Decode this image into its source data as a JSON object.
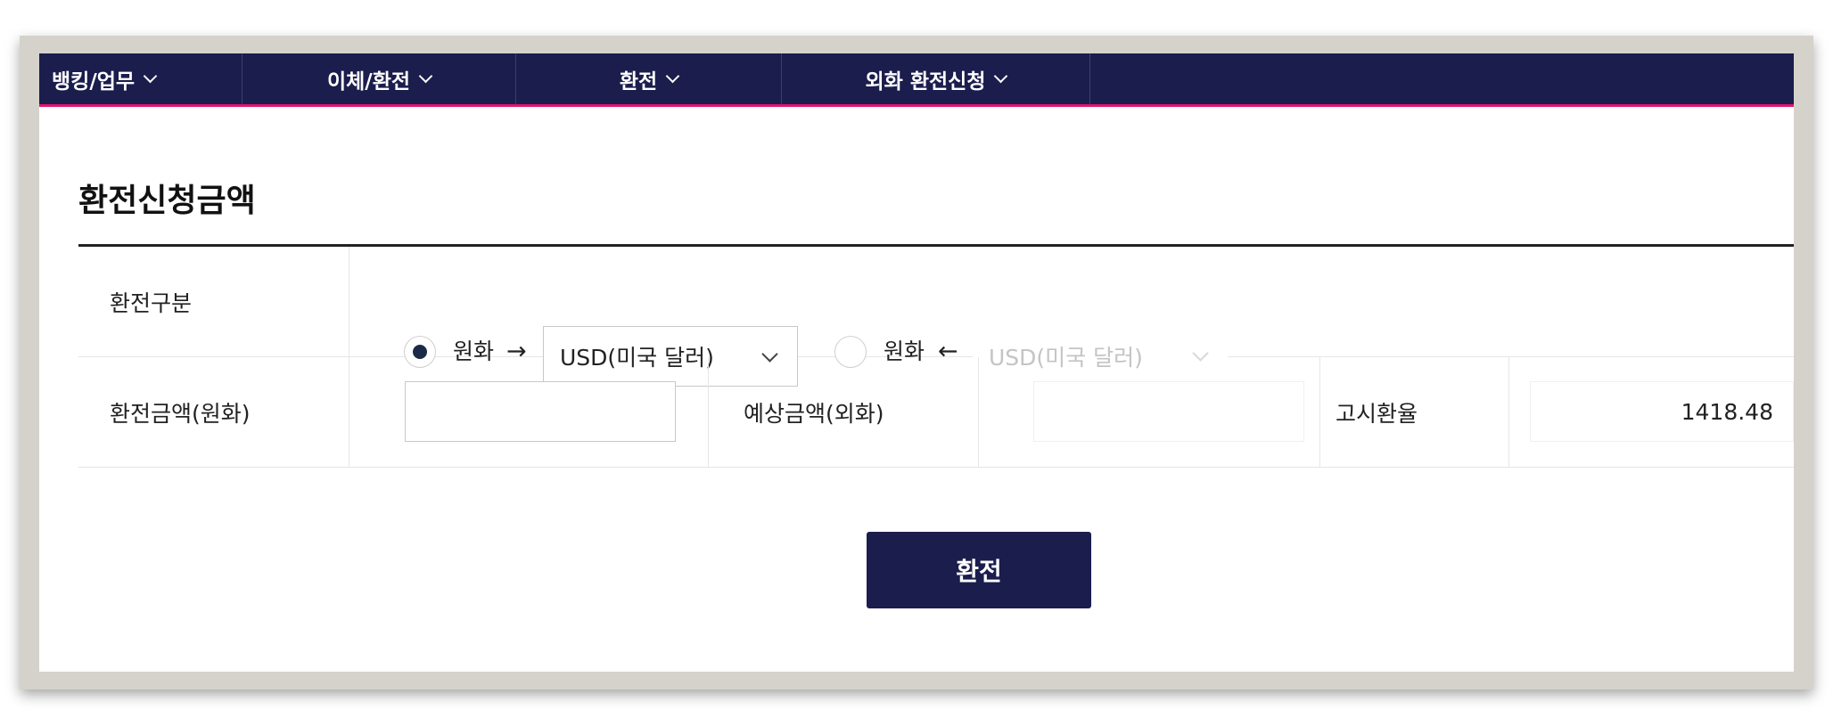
{
  "nav": {
    "items": [
      {
        "label": "뱅킹/업무",
        "icon": "chevron-down-icon"
      },
      {
        "label": "이체/환전",
        "icon": "chevron-down-icon"
      },
      {
        "label": "환전",
        "icon": "chevron-down-icon"
      },
      {
        "label": "외화 환전신청",
        "icon": "chevron-down-icon"
      }
    ],
    "background": "#1b1d4d",
    "accent_line": "#e0166e"
  },
  "section": {
    "title": "환전신청금액"
  },
  "form": {
    "exchange_type": {
      "label": "환전구분",
      "option_buy": {
        "from": "원화",
        "arrow": "→",
        "currency_selected": "USD(미국 달러)",
        "checked": true
      },
      "option_sell": {
        "to": "원화",
        "arrow": "←",
        "currency_selected": "USD(미국 달러)",
        "checked": false
      }
    },
    "amount_krw": {
      "label": "환전금액(원화)",
      "value": ""
    },
    "expected_amount": {
      "label": "예상금액(외화)",
      "value": ""
    },
    "notice_rate": {
      "label": "고시환율",
      "value": "1418.48"
    }
  },
  "actions": {
    "submit_label": "환전"
  },
  "colors": {
    "primary": "#1b1d4d",
    "radio_checked": "#1c2a4a"
  }
}
